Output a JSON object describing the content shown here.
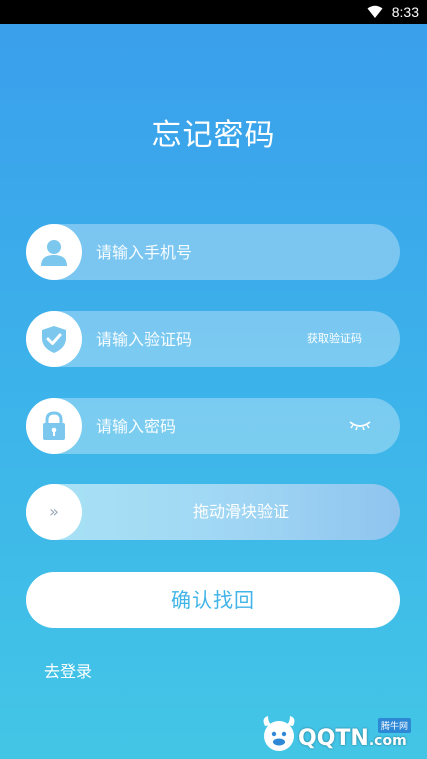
{
  "status_bar": {
    "time": "8:33",
    "wifi_icon": "wifi-icon"
  },
  "page": {
    "title": "忘记密码"
  },
  "form": {
    "phone": {
      "placeholder": "请输入手机号",
      "icon": "user-icon"
    },
    "code": {
      "placeholder": "请输入验证码",
      "icon": "shield-check-icon",
      "get_code_label": "获取验证码"
    },
    "password": {
      "placeholder": "请输入密码",
      "icon": "lock-icon",
      "toggle_icon": "eye-closed-icon"
    },
    "slider": {
      "handle_text": "»",
      "label": "拖动滑块验证"
    },
    "confirm_label": "确认找回",
    "login_link": "去登录"
  },
  "watermark": {
    "brand": "QQTN",
    "suffix": ".com",
    "tag": "腾牛网"
  },
  "colors": {
    "bg_top": "#3a9eec",
    "bg_bottom": "#43c6e6",
    "icon_blue": "#7cc7ee",
    "confirm_text": "#41b4e8"
  }
}
